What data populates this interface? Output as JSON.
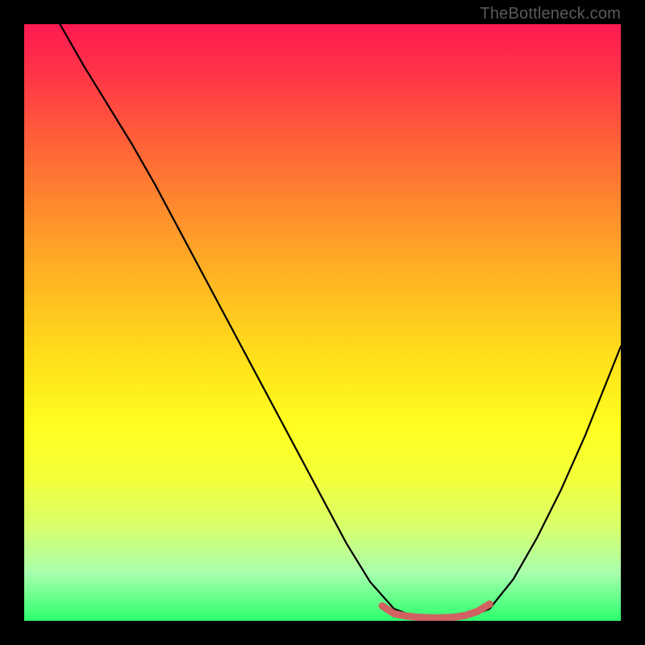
{
  "attribution": "TheBottleneck.com",
  "chart_data": {
    "type": "line",
    "xlabel": "",
    "ylabel": "",
    "xlim": [
      0,
      100
    ],
    "ylim": [
      0,
      100
    ],
    "grid": false,
    "title": "",
    "series": [
      {
        "name": "bottleneck-curve",
        "x": [
          6,
          10,
          14,
          18,
          22,
          26,
          30,
          34,
          38,
          42,
          46,
          50,
          54,
          58,
          62,
          66,
          70,
          74,
          78,
          82,
          86,
          90,
          94,
          98,
          100
        ],
        "y": [
          100,
          93,
          86.5,
          80,
          73,
          65.5,
          58,
          50.5,
          43,
          35.5,
          28,
          20.5,
          13,
          6.5,
          2,
          0.5,
          0.3,
          0.5,
          2,
          7,
          14,
          22,
          31,
          41,
          46
        ]
      },
      {
        "name": "optimal-band",
        "x": [
          60,
          62,
          64,
          66,
          68,
          70,
          72,
          74,
          76,
          78
        ],
        "y": [
          2.5,
          1.2,
          0.8,
          0.6,
          0.5,
          0.5,
          0.6,
          0.9,
          1.6,
          2.8
        ]
      }
    ],
    "colors": {
      "curve": "#000000",
      "band": "#d06262"
    }
  }
}
